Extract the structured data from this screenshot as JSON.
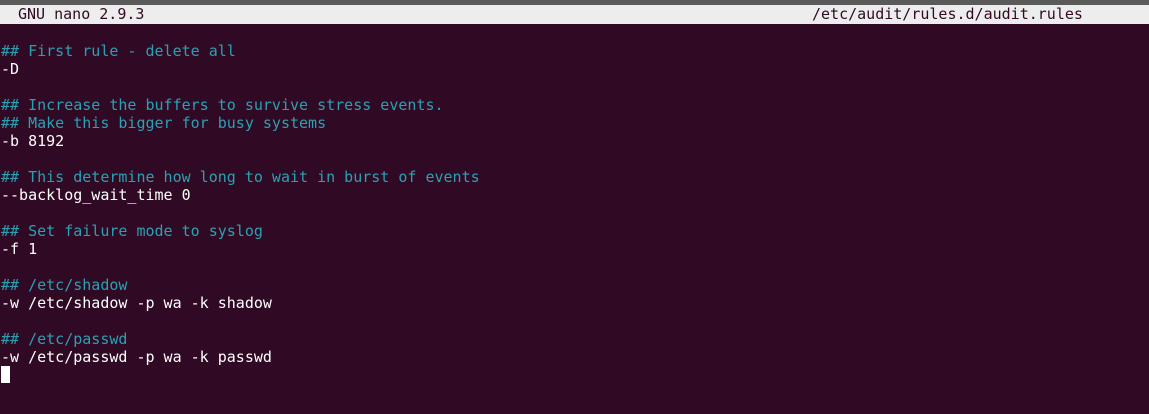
{
  "app": {
    "name_version": "GNU nano 2.9.3",
    "file_path": "/etc/audit/rules.d/audit.rules"
  },
  "colors": {
    "background": "#300a24",
    "comment": "#2aa1b3",
    "text": "#ffffff",
    "title_bar": "#ededed"
  },
  "lines": [
    {
      "type": "comment",
      "text": "## First rule - delete all"
    },
    {
      "type": "code",
      "text": "-D"
    },
    {
      "type": "blank",
      "text": ""
    },
    {
      "type": "comment",
      "text": "## Increase the buffers to survive stress events."
    },
    {
      "type": "comment",
      "text": "## Make this bigger for busy systems"
    },
    {
      "type": "code",
      "text": "-b 8192"
    },
    {
      "type": "blank",
      "text": ""
    },
    {
      "type": "comment",
      "text": "## This determine how long to wait in burst of events"
    },
    {
      "type": "code",
      "text": "--backlog_wait_time 0"
    },
    {
      "type": "blank",
      "text": ""
    },
    {
      "type": "comment",
      "text": "## Set failure mode to syslog"
    },
    {
      "type": "code",
      "text": "-f 1"
    },
    {
      "type": "blank",
      "text": ""
    },
    {
      "type": "comment",
      "text": "## /etc/shadow"
    },
    {
      "type": "code",
      "text": "-w /etc/shadow -p wa -k shadow"
    },
    {
      "type": "blank",
      "text": ""
    },
    {
      "type": "comment",
      "text": "## /etc/passwd"
    },
    {
      "type": "code",
      "text": "-w /etc/passwd -p wa -k passwd"
    }
  ]
}
